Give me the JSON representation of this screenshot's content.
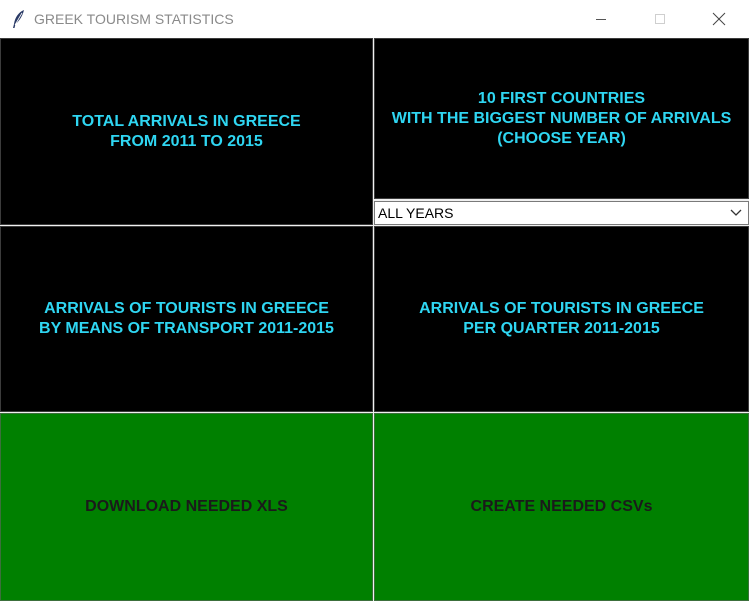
{
  "window": {
    "title": "GREEK TOURISM STATISTICS",
    "icons": [
      "feather-icon",
      "minimize-icon",
      "maximize-icon",
      "close-icon"
    ]
  },
  "tiles": {
    "total_arrivals": "TOTAL ARRIVALS IN GREECE\nFROM 2011 TO 2015",
    "top_countries": "10 FIRST COUNTRIES\nWITH THE BIGGEST NUMBER OF ARRIVALS\n(CHOOSE YEAR)",
    "by_transport": "ARRIVALS OF TOURISTS IN GREECE\nBY MEANS OF TRANSPORT 2011-2015",
    "per_quarter": "ARRIVALS OF TOURISTS IN GREECE\nPER QUARTER 2011-2015"
  },
  "year_select": {
    "selected": "ALL YEARS"
  },
  "actions": {
    "download_xls": "DOWNLOAD NEEDED XLS",
    "create_csvs": "CREATE NEEDED CSVs"
  },
  "colors": {
    "tile_bg": "#000000",
    "tile_text": "#2fd6f2",
    "action_bg": "#008000",
    "action_text": "#1a1a1a"
  }
}
